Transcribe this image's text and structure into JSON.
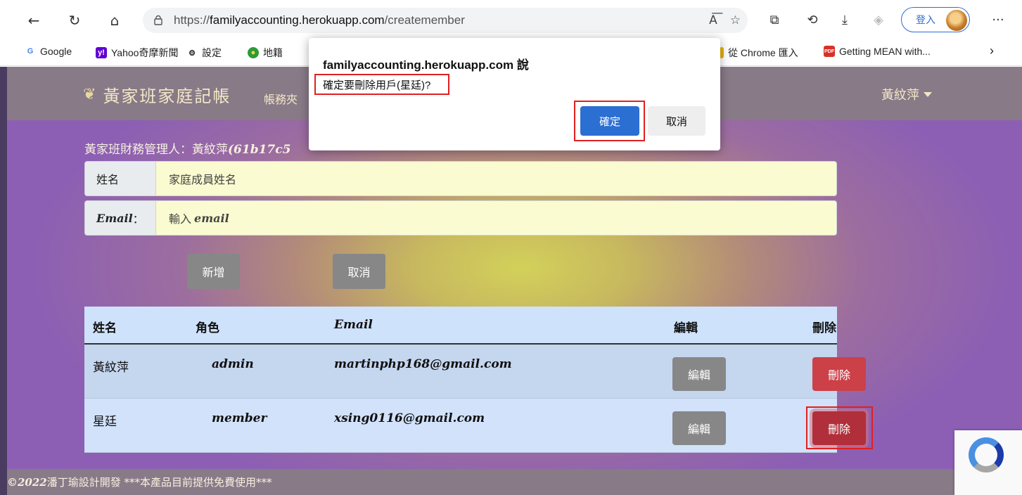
{
  "browser": {
    "url_prefix": "https://",
    "url_host": "familyaccounting.herokuapp.com",
    "url_path": "/createmember",
    "login_label": "登入",
    "bookmarks": [
      {
        "label": "Google",
        "icon": "google-icon"
      },
      {
        "label": "Yahoo奇摩新聞",
        "icon": "yahoo-icon"
      },
      {
        "label": "設定",
        "icon": "gear-icon"
      },
      {
        "label": "地籍",
        "icon": "globe-icon"
      },
      {
        "label": "從 Chrome 匯入",
        "icon": "import-icon"
      },
      {
        "label": "Getting MEAN with...",
        "icon": "pdf-icon"
      }
    ]
  },
  "navbar": {
    "brand": "黃家班家庭記帳",
    "link": "帳務夾",
    "user": "黃紋萍"
  },
  "manager": {
    "label": "黃家班財務管理人：黃紋萍",
    "id": "(61b17c5"
  },
  "form": {
    "name_label": "姓名",
    "name_placeholder": "家庭成員姓名",
    "email_label": "Email",
    "email_label_suffix": "：",
    "email_placeholder_prefix": "輸入",
    "email_placeholder_word": "email",
    "add_button": "新增",
    "cancel_button": "取消"
  },
  "table": {
    "headers": [
      "姓名",
      "角色",
      "Email",
      "編輯",
      "刪除"
    ],
    "rows": [
      {
        "name": "黃紋萍",
        "role": "admin",
        "email": "martinphp168@gmail.com",
        "edit": "編輯",
        "delete": "刪除"
      },
      {
        "name": "星廷",
        "role": "member",
        "email": "xsing0116@gmail.com",
        "edit": "編輯",
        "delete": "刪除"
      }
    ]
  },
  "footer": {
    "year": "©2022",
    "text": " 潘丁瑜設計開發 ***本產品目前提供免費使用***"
  },
  "dialog": {
    "title": "familyaccounting.herokuapp.com 說",
    "message": "確定要刪除用戶(星廷)?",
    "ok": "確定",
    "cancel": "取消"
  },
  "colors": {
    "accent_blue": "#2c6fd3",
    "danger_red": "#cc4048",
    "navbar": "#897a87",
    "input_bg": "#fafbd0",
    "table_header": "#cfe2fb"
  }
}
